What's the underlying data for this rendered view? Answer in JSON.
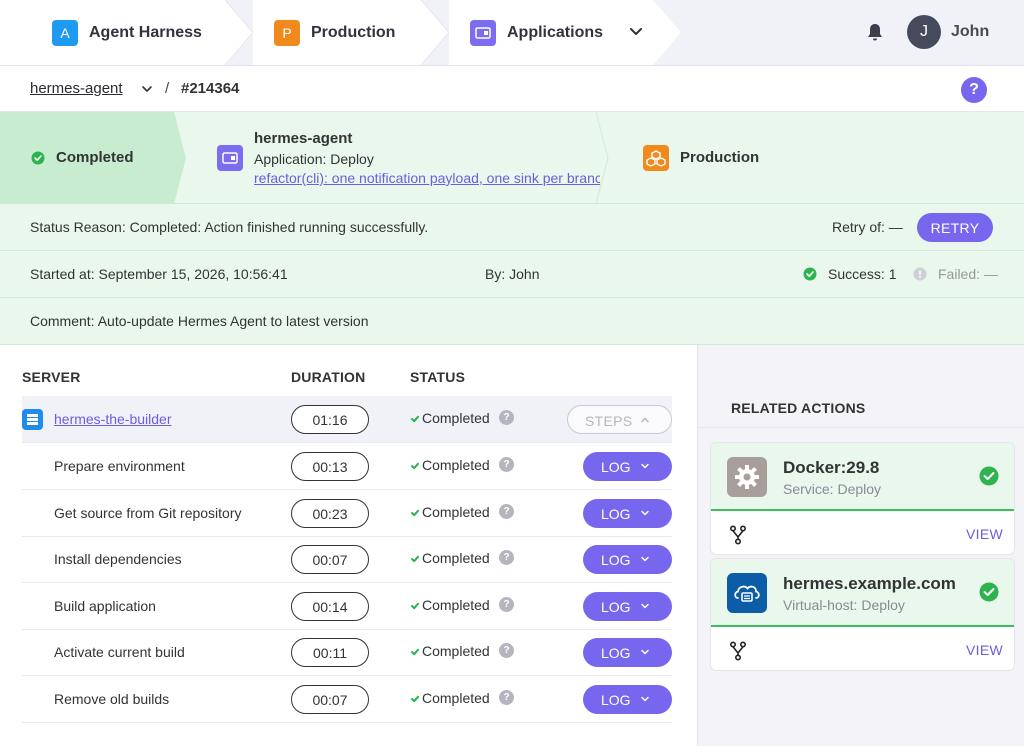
{
  "topnav": {
    "items": [
      {
        "badge": "A",
        "label": "Agent Harness",
        "color": "#1e9bf0"
      },
      {
        "badge": "P",
        "label": "Production",
        "color": "#f08a1c"
      },
      {
        "badge": "",
        "label": "Applications",
        "color": "#7c6cf0"
      }
    ],
    "dropdown_icon": "chevron-down-icon",
    "notification_icon": "bell-icon",
    "user": {
      "initial": "J",
      "name": "John"
    }
  },
  "breadcrumb": {
    "agent": "hermes-agent",
    "separator": "/",
    "run_id": "#214364",
    "help": "?"
  },
  "pipeline": {
    "completed_label": "Completed",
    "app": {
      "name": "hermes-agent",
      "action": "Application: Deploy",
      "commit": "refactor(cli): one notification payload, one sink per branch"
    },
    "environment": "Production"
  },
  "info": {
    "status_reason": "Status Reason: Completed: Action finished running successfully.",
    "retry_of": "Retry of: —",
    "retry_button": "RETRY",
    "started_at": "Started at: September 15, 2026, 10:56:41",
    "by": "By: John",
    "success": "Success: 1",
    "failed": "Failed: —",
    "comment": "Comment: Auto-update Hermes Agent to latest version"
  },
  "table": {
    "headers": {
      "server": "SERVER",
      "duration": "DURATION",
      "status": "STATUS"
    },
    "server": {
      "name": "hermes-the-builder",
      "duration": "01:16",
      "status": "Completed",
      "button": "STEPS"
    },
    "steps": [
      {
        "name": "Prepare environment",
        "duration": "00:13",
        "status": "Completed",
        "button": "LOG"
      },
      {
        "name": "Get source from Git repository",
        "duration": "00:23",
        "status": "Completed",
        "button": "LOG"
      },
      {
        "name": "Install dependencies",
        "duration": "00:07",
        "status": "Completed",
        "button": "LOG"
      },
      {
        "name": "Build application",
        "duration": "00:14",
        "status": "Completed",
        "button": "LOG"
      },
      {
        "name": "Activate current build",
        "duration": "00:11",
        "status": "Completed",
        "button": "LOG"
      },
      {
        "name": "Remove old builds",
        "duration": "00:07",
        "status": "Completed",
        "button": "LOG"
      }
    ]
  },
  "related": {
    "title": "RELATED ACTIONS",
    "cards": [
      {
        "title": "Docker:29.8",
        "subtitle": "Service: Deploy",
        "view": "VIEW",
        "icon": "gear-icon"
      },
      {
        "title": "hermes.example.com",
        "subtitle": "Virtual-host: Deploy",
        "view": "VIEW",
        "icon": "cloud-icon"
      }
    ]
  },
  "colors": {
    "accent": "#7766ee",
    "success": "#3dbe5e",
    "success_bg": "#eaf7ec"
  }
}
